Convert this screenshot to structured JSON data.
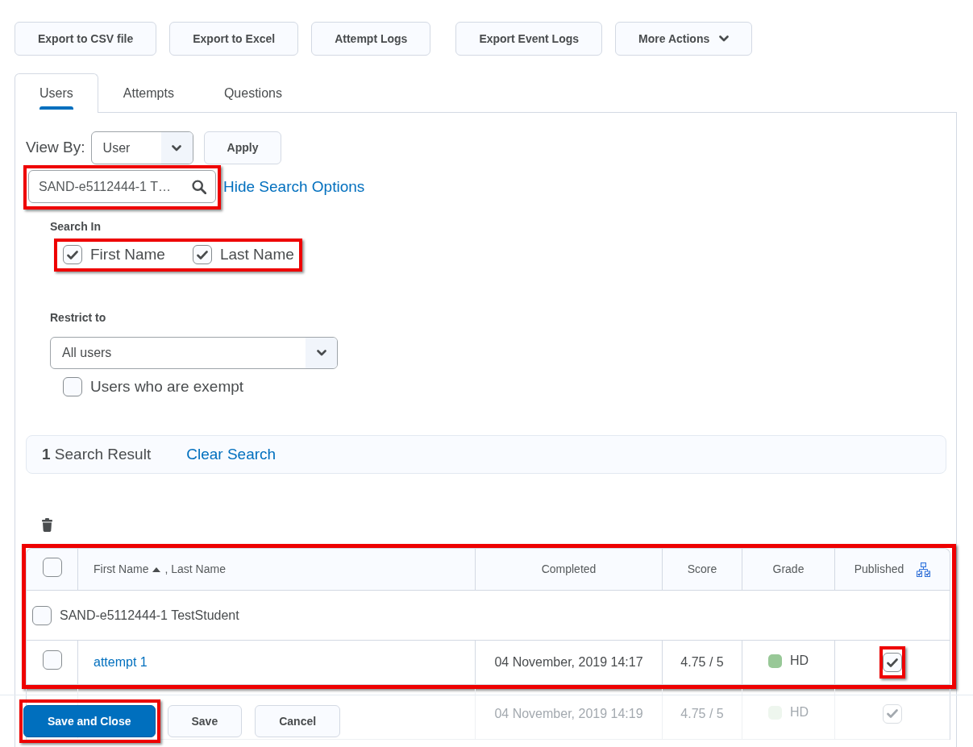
{
  "toolbar": {
    "groups": [
      [
        {
          "label": "Export to CSV file",
          "kind": "plain"
        },
        {
          "label": "Export to Excel",
          "kind": "plain"
        },
        {
          "label": "Attempt Logs",
          "kind": "plain"
        }
      ],
      [
        {
          "label": "Export Event Logs",
          "kind": "plain"
        },
        {
          "label": "More Actions",
          "kind": "menu"
        }
      ]
    ]
  },
  "tabs": [
    {
      "label": "Users",
      "selected": true
    },
    {
      "label": "Attempts",
      "selected": false
    },
    {
      "label": "Questions",
      "selected": false
    }
  ],
  "view_by": {
    "label": "View By:",
    "value": "User",
    "button": "Apply"
  },
  "search": {
    "value": "SAND-e5112444-1 T…",
    "highlighted": true,
    "link": "Hide Search Options"
  },
  "search_in": {
    "label": "Search In",
    "highlighted": true,
    "options": [
      {
        "label": "First Name",
        "checked": true
      },
      {
        "label": "Last Name",
        "checked": true
      }
    ]
  },
  "restrict_to": {
    "label": "Restrict to",
    "value": "All users",
    "options": [
      {
        "label": "Users who are exempt",
        "checked": false
      }
    ]
  },
  "results": {
    "text": "**1** Search Result",
    "link": "Clear Search"
  },
  "table": {
    "header_highlighted": true,
    "columns": [
      {
        "kind": "select",
        "checked": false
      },
      {
        "kind": "sort",
        "label": "First Name",
        "sort_ascending": true,
        "secondary": ", Last Name"
      },
      {
        "kind": "text",
        "label": "Completed"
      },
      {
        "kind": "text",
        "label": "Score"
      },
      {
        "kind": "text",
        "label": "Grade"
      },
      {
        "kind": "publish",
        "label": "Published"
      }
    ],
    "groups": [
      {
        "name": "SAND-e5112444-1 TestStudent",
        "checked": false,
        "highlighted": true,
        "attempts": [
          {
            "name": "attempt 1",
            "checked": false,
            "completed": "04 November, 2019 14:17",
            "score": "4.75 / 5",
            "grade": "HD",
            "color": "#98c897",
            "published": true,
            "published_highlighted": true,
            "highlighted": true,
            "faded": false
          },
          {
            "completed": "04 November, 2019 14:19",
            "score": "4.75 / 5",
            "grade": "HD",
            "color": "#eef6ee",
            "published": true,
            "published_highlighted": false,
            "highlighted": false,
            "faded": true
          }
        ]
      }
    ]
  },
  "footer": {
    "buttons": [
      {
        "label": "Save and Close",
        "kind": "primary",
        "highlighted": true
      },
      {
        "label": "Save",
        "kind": "secondary",
        "highlighted": false
      },
      {
        "label": "Cancel",
        "kind": "secondary",
        "highlighted": false
      }
    ]
  }
}
